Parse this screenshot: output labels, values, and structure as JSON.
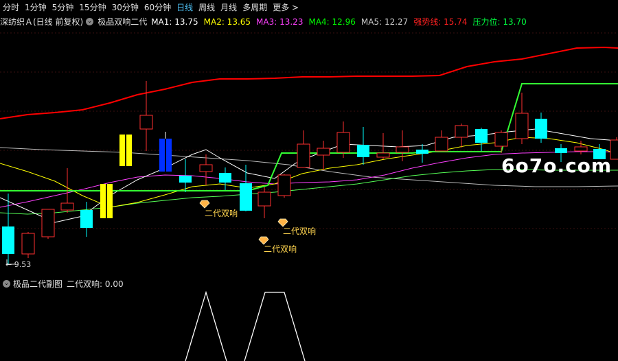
{
  "tabs": [
    "分时",
    "1分钟",
    "5分钟",
    "15分钟",
    "30分钟",
    "60分钟",
    "日线",
    "周线",
    "月线",
    "多周期",
    "更多 >"
  ],
  "active_tab": 6,
  "info": {
    "stock": "深纺织Ａ(日线 前复权)",
    "indicator": "极品双响二代",
    "items": [
      {
        "label": "MA1: 13.75",
        "color": "#ffffff"
      },
      {
        "label": "MA2: 13.65",
        "color": "#ffff00"
      },
      {
        "label": "MA3: 13.23",
        "color": "#ff40ff"
      },
      {
        "label": "MA4: 12.96",
        "color": "#00ff00"
      },
      {
        "label": "MA5: 12.27",
        "color": "#cccccc"
      },
      {
        "label": "强势线: 15.74",
        "color": "#ff2020"
      },
      {
        "label": "压力位: 13.70",
        "color": "#00ff40"
      }
    ]
  },
  "signal_label": "二代双响",
  "low_label": "9.53",
  "watermark": "6o7o.com",
  "sub": {
    "title": "极品二代副图",
    "value": "二代双响: 0.00"
  },
  "colors": {
    "up": "#ff3030",
    "down": "#00ffff",
    "red_line": "#ff0000",
    "green_line": "#33ff33"
  }
}
